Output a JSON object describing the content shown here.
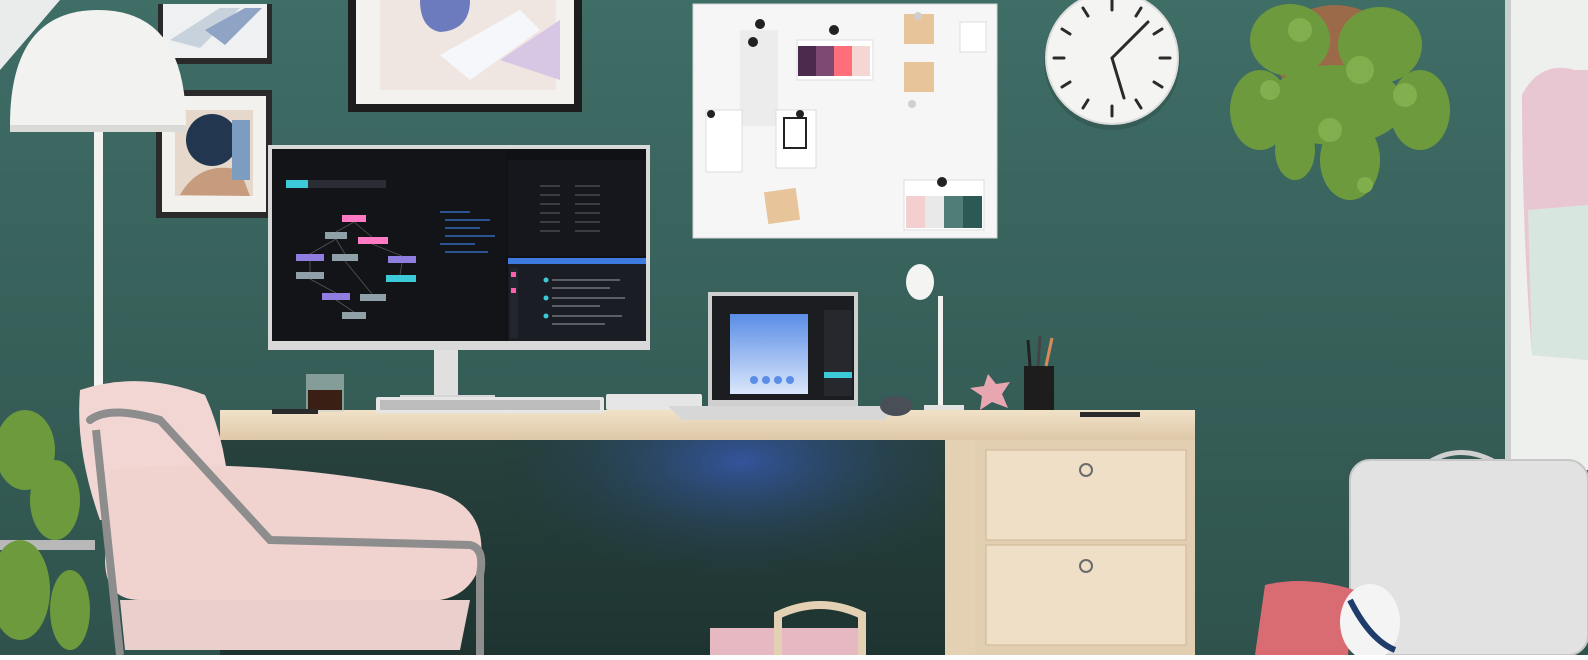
{
  "scene": {
    "description_colors": {
      "wall": "#3f6b64",
      "wall_shadow": "#2f534d",
      "desk_wood": "#e8d6bb",
      "chair_pink": "#f2d6d3",
      "frame": "#1f1f1f",
      "accent_blue": "#3d7be0",
      "cyan": "#3cc9d8"
    }
  },
  "icons": [
    "clock-icon",
    "lamp-icon",
    "plant-icon"
  ]
}
